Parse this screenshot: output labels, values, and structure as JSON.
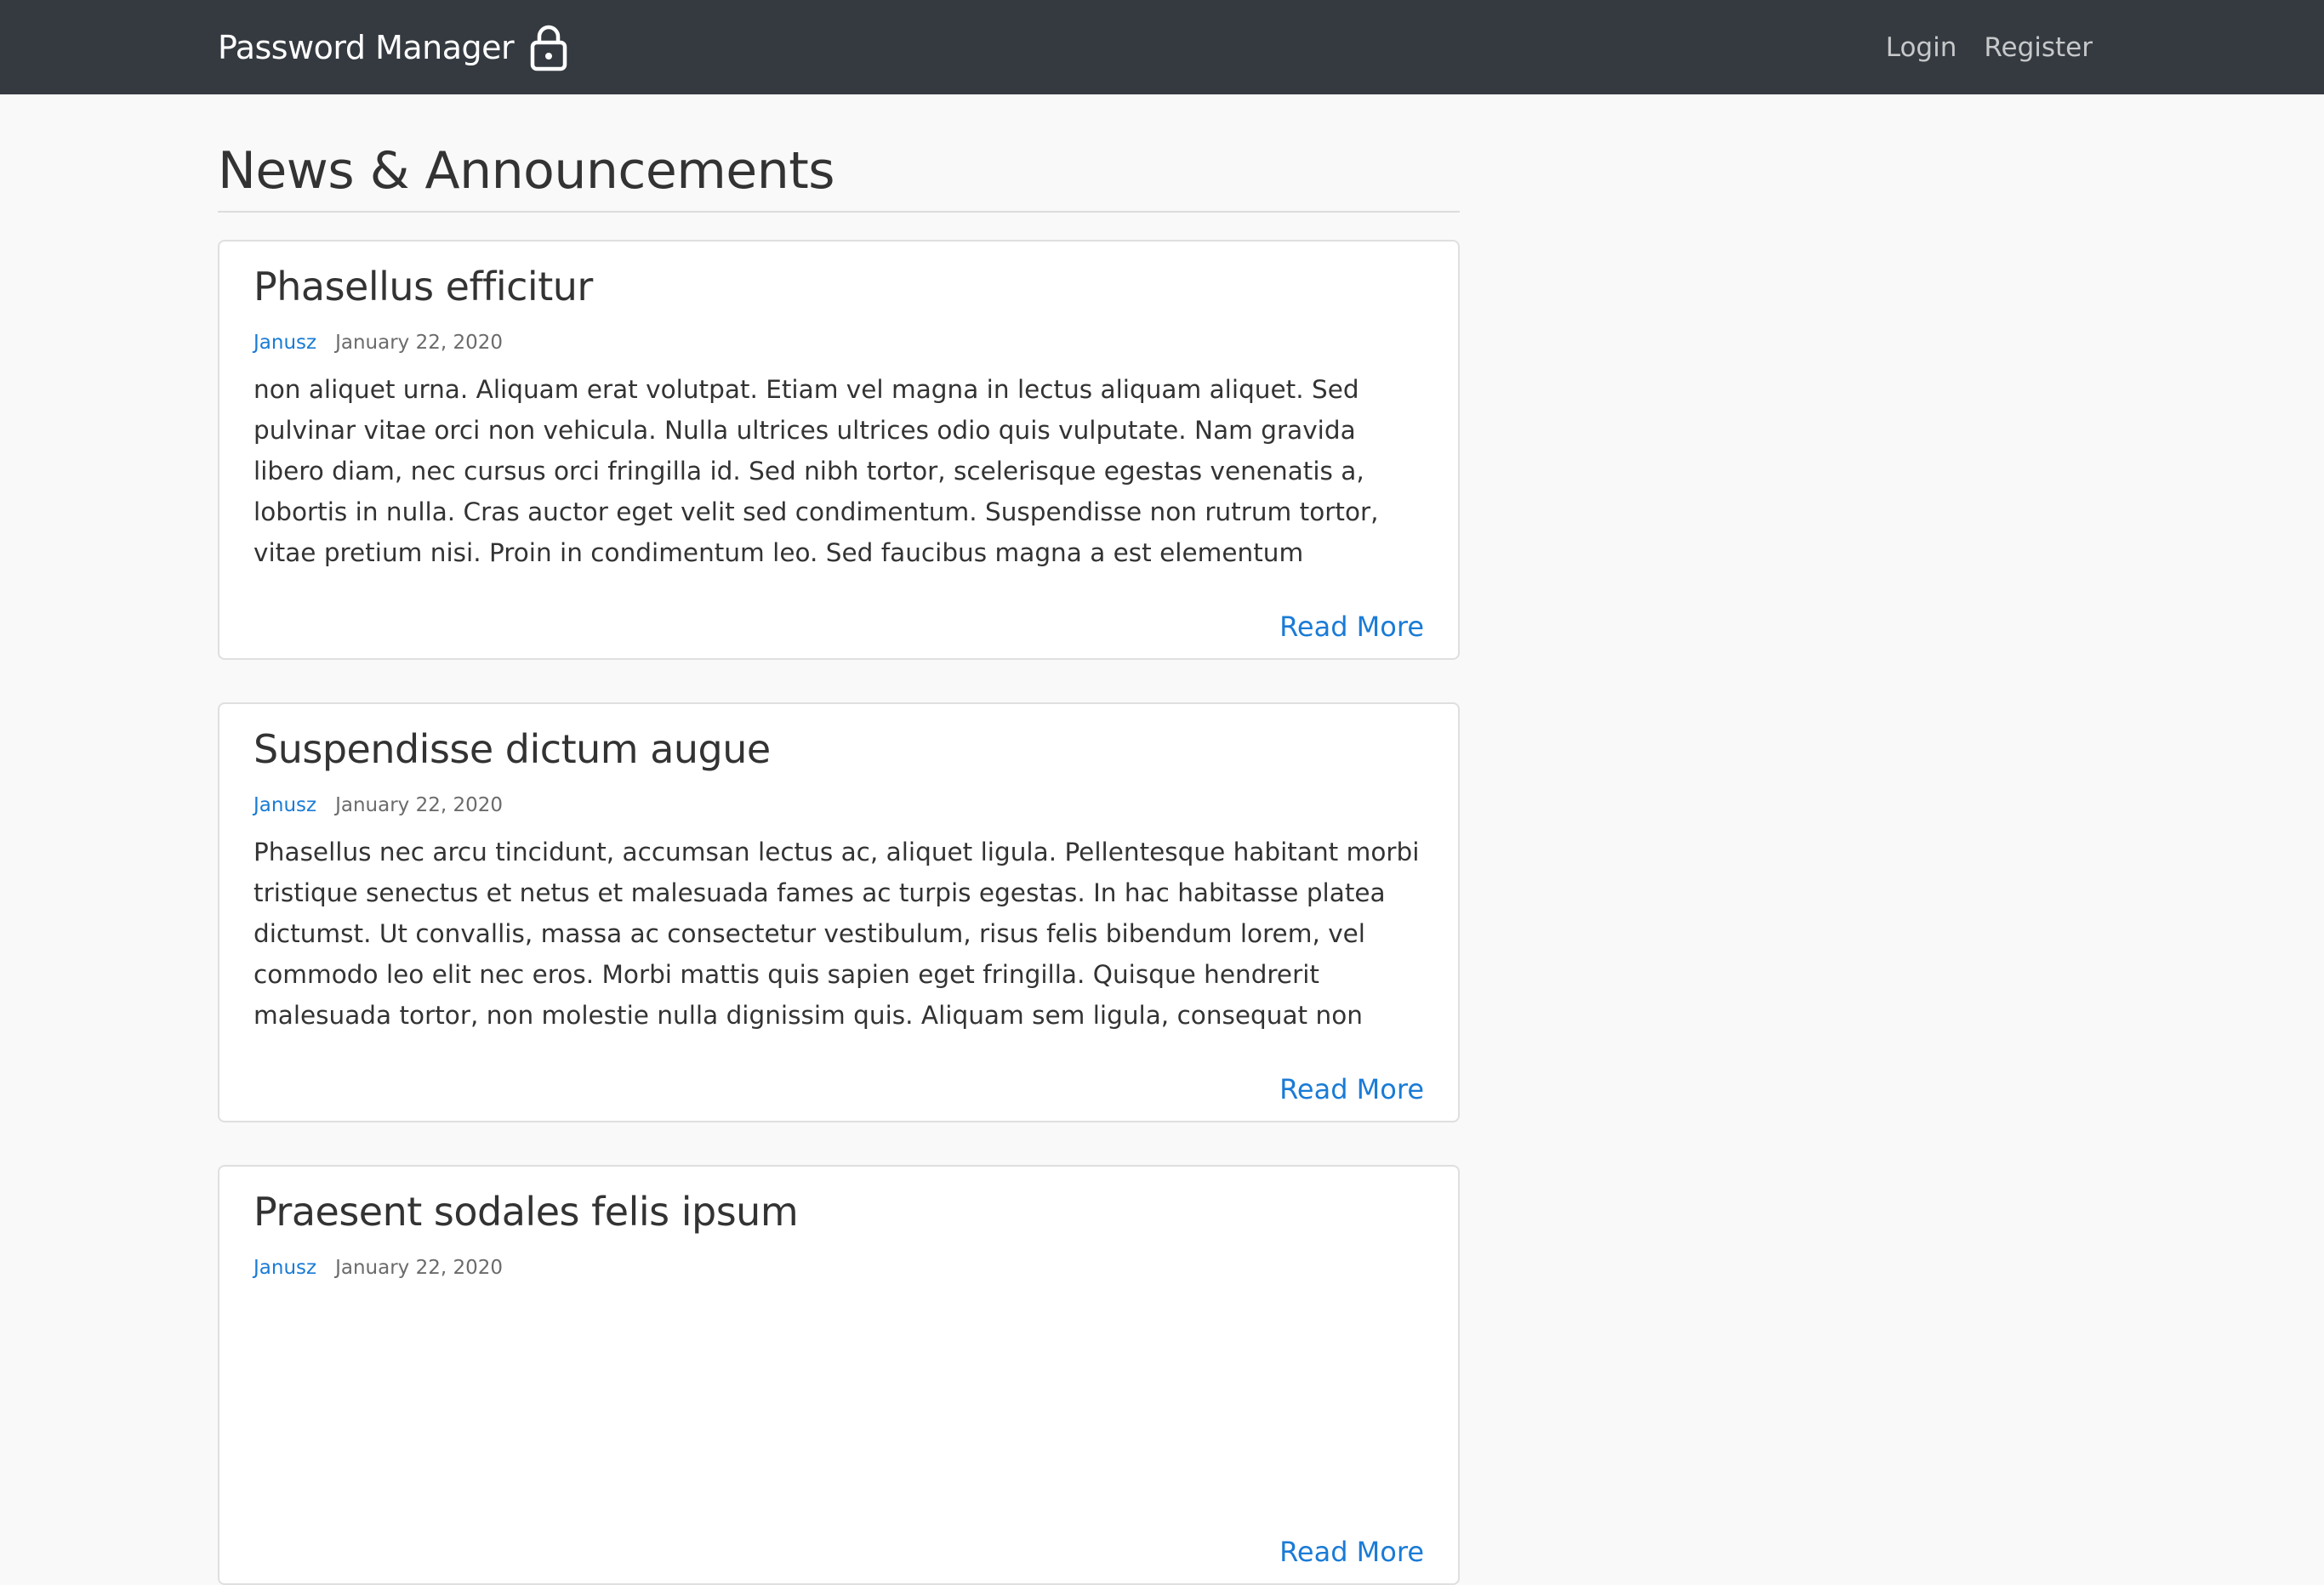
{
  "navbar": {
    "brand": "Password Manager",
    "brand_icon": "lock-icon",
    "links": [
      "Login",
      "Register"
    ]
  },
  "main": {
    "title": "News & Announcements",
    "posts": [
      {
        "title": "Phasellus efficitur",
        "author": "Janusz",
        "date": "January 22, 2020",
        "excerpt": "non aliquet urna. Aliquam erat volutpat. Etiam vel magna in lectus aliquam aliquet. Sed pulvinar vitae orci non vehicula. Nulla ultrices ultrices odio quis vulputate. Nam gravida libero diam, nec cursus orci fringilla id. Sed nibh tortor, scelerisque egestas venenatis a, lobortis in nulla. Cras auctor eget velit sed condimentum. Suspendisse non rutrum tortor, vitae pretium nisi. Proin in condimentum leo. Sed faucibus magna a est elementum elementum. Donec dictum elit magna, a",
        "read_more": "Read More"
      },
      {
        "title": "Suspendisse dictum augue",
        "author": "Janusz",
        "date": "January 22, 2020",
        "excerpt": "Phasellus nec arcu tincidunt, accumsan lectus ac, aliquet ligula. Pellentesque habitant morbi tristique senectus et netus et malesuada fames ac turpis egestas. In hac habitasse platea dictumst. Ut convallis, massa ac consectetur vestibulum, risus felis bibendum lorem, vel commodo leo elit nec eros. Morbi mattis quis sapien eget fringilla. Quisque hendrerit malesuada tortor, non molestie nulla dignissim quis. Aliquam sem ligula, consequat non arcu id, tincidunt",
        "read_more": "Read More"
      },
      {
        "title": "Praesent sodales felis ipsum",
        "author": "Janusz",
        "date": "January 22, 2020",
        "excerpt": "",
        "read_more": "Read More"
      }
    ]
  },
  "colors": {
    "navbar_bg": "#343a40",
    "link": "#1a7bd6",
    "page_bg": "#f9f9f9"
  }
}
